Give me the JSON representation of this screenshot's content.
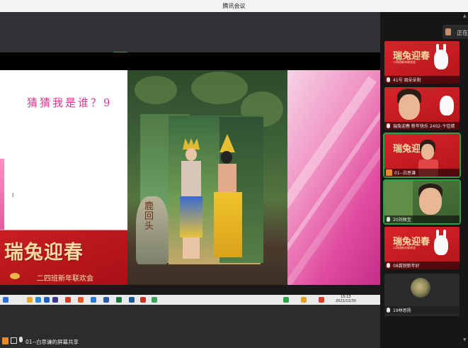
{
  "window": {
    "title": "腾讯会议"
  },
  "slide": {
    "title": "猜猜我是谁？9",
    "cursor": "I",
    "banner_main": "瑞兔迎春",
    "banner_sub": "二四班新年联欢会",
    "rock_text": "鹿回头"
  },
  "taskbar": {
    "time": "15:13",
    "date": "2022/12/30"
  },
  "status_bar": {
    "sharing_text": "01--白思谦的屏幕共享"
  },
  "sidebar": {
    "header_button": "正在",
    "participants": [
      {
        "name": "41号 周朵朵阳",
        "tile": "slide",
        "name_icon": "mic-icon"
      },
      {
        "name": "瑞兔迎春 新年快乐 2402-卞佳婧",
        "tile": "camera",
        "name_icon": "mic-icon"
      },
      {
        "name": "01--白思谦",
        "tile": "camera",
        "name_icon": "user-icon",
        "active": true
      },
      {
        "name": "20刘佩宝",
        "tile": "camera",
        "name_icon": "mic-icon",
        "active": true
      },
      {
        "name": "08龚锐新年好",
        "tile": "slide",
        "name_icon": "mic-icon"
      },
      {
        "name": "19林思扬",
        "tile": "avatar",
        "name_icon": "mic-icon"
      }
    ],
    "tile_title": "瑞兔迎春",
    "tile_sub": "二四班新年联欢会"
  }
}
